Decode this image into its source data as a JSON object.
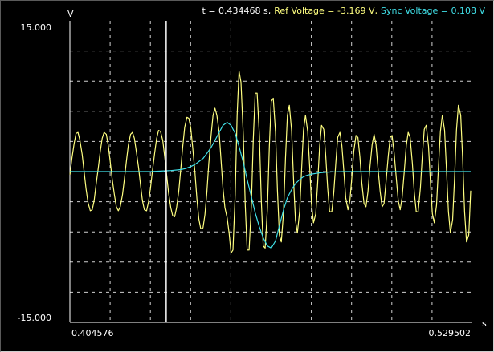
{
  "colors": {
    "background": "#000000",
    "grid": "#d0d0d0",
    "axes": "#ffffff",
    "ref": "#ffff80",
    "sync": "#40e0e8",
    "cursor": "#ffffff",
    "text": "#ffffff"
  },
  "readout": {
    "time": "t = 0.434468 s,",
    "ref": "Ref Voltage = -3.169 V,",
    "sync": "Sync Voltage =  0.108 V"
  },
  "chart_data": {
    "type": "line",
    "xlabel": "s",
    "ylabel": "V",
    "xlim": [
      0.404576,
      0.529502
    ],
    "ylim": [
      -15.0,
      15.0
    ],
    "x_tick_labels": [
      "0.404576",
      "0.529502"
    ],
    "y_tick_labels": [
      "15.000",
      "-15.000"
    ],
    "grid": true,
    "grid_divisions": {
      "x": 10,
      "y": 10
    },
    "cursor_x": 0.434468,
    "series": [
      {
        "name": "Ref Voltage",
        "color": "#ffff80",
        "x": [
          0.4046,
          0.4052,
          0.4059,
          0.4065,
          0.4071,
          0.4077,
          0.4084,
          0.409,
          0.4096,
          0.4102,
          0.4109,
          0.4115,
          0.4121,
          0.4127,
          0.4134,
          0.414,
          0.4146,
          0.4152,
          0.4159,
          0.4165,
          0.4171,
          0.4177,
          0.4184,
          0.419,
          0.4196,
          0.4202,
          0.4209,
          0.4215,
          0.4221,
          0.4227,
          0.4234,
          0.424,
          0.4246,
          0.4252,
          0.4259,
          0.4265,
          0.4271,
          0.4277,
          0.4284,
          0.429,
          0.4296,
          0.4302,
          0.4309,
          0.4315,
          0.4321,
          0.4327,
          0.4334,
          0.434,
          0.4346,
          0.4352,
          0.4359,
          0.4365,
          0.4371,
          0.4377,
          0.4384,
          0.439,
          0.4396,
          0.4402,
          0.4409,
          0.4415,
          0.4421,
          0.4427,
          0.4434,
          0.444,
          0.4446,
          0.4452,
          0.4459,
          0.4465,
          0.4471,
          0.4477,
          0.4484,
          0.449,
          0.4496,
          0.4502,
          0.4509,
          0.4515,
          0.4521,
          0.4527,
          0.4534,
          0.454,
          0.4546,
          0.4552,
          0.4559,
          0.4565,
          0.4571,
          0.4577,
          0.4584,
          0.459,
          0.4596,
          0.4602,
          0.4609,
          0.4615,
          0.4621,
          0.4627,
          0.4634,
          0.464,
          0.4646,
          0.4652,
          0.4659,
          0.4665,
          0.4671,
          0.4677,
          0.4684,
          0.469,
          0.4696,
          0.4702,
          0.4709,
          0.4715,
          0.4721,
          0.4727,
          0.4734,
          0.474,
          0.4746,
          0.4752,
          0.4759,
          0.4765,
          0.4771,
          0.4777,
          0.4784,
          0.479,
          0.4796,
          0.4802,
          0.4809,
          0.4815,
          0.4821,
          0.4827,
          0.4834,
          0.484,
          0.4846,
          0.4852,
          0.4859,
          0.4865,
          0.4871,
          0.4877,
          0.4884,
          0.489,
          0.4896,
          0.4902,
          0.4909,
          0.4915,
          0.4921,
          0.4927,
          0.4934,
          0.494,
          0.4946,
          0.4952,
          0.4959,
          0.4965,
          0.4971,
          0.4977,
          0.4984,
          0.499,
          0.4996,
          0.5002,
          0.5009,
          0.5015,
          0.5021,
          0.5027,
          0.5034,
          0.504,
          0.5046,
          0.5052,
          0.5059,
          0.5065,
          0.5071,
          0.5077,
          0.5084,
          0.509,
          0.5096,
          0.5102,
          0.5109,
          0.5115,
          0.5121,
          0.5127,
          0.5134,
          0.514,
          0.5146,
          0.5152,
          0.5159,
          0.5165,
          0.5171,
          0.5177,
          0.5184,
          0.519,
          0.5196,
          0.5202,
          0.5209,
          0.5215,
          0.5221,
          0.5227,
          0.5234,
          0.524,
          0.5246,
          0.5252,
          0.5259,
          0.5265,
          0.5271,
          0.5277,
          0.5284,
          0.529
        ],
        "y": [
          -0.3,
          1.3,
          2.8,
          3.8,
          3.9,
          3.1,
          1.7,
          0.0,
          -1.7,
          -3.1,
          -3.9,
          -3.8,
          -2.9,
          -1.3,
          0.4,
          2.0,
          3.3,
          3.9,
          3.7,
          2.6,
          1.0,
          -0.7,
          -2.3,
          -3.5,
          -3.9,
          -3.5,
          -2.3,
          -0.7,
          1.0,
          2.6,
          3.7,
          3.9,
          3.3,
          2.0,
          0.4,
          -1.3,
          -2.9,
          -3.8,
          -3.9,
          -3.0,
          -1.6,
          0.1,
          1.9,
          3.3,
          4.1,
          4.0,
          3.1,
          1.5,
          -0.3,
          -2.1,
          -3.6,
          -4.4,
          -4.5,
          -3.6,
          -1.9,
          0.3,
          2.5,
          4.4,
          5.4,
          5.3,
          4.3,
          2.4,
          -0.1,
          -2.7,
          -4.7,
          -5.7,
          -5.6,
          -4.3,
          -2.1,
          0.8,
          3.6,
          5.6,
          6.3,
          5.6,
          3.9,
          1.1,
          -1.7,
          -3.6,
          -4.6,
          -6.1,
          -8.1,
          -7.8,
          -2.3,
          5.6,
          10.0,
          8.9,
          3.6,
          -3.3,
          -7.8,
          -7.8,
          -3.4,
          3.2,
          7.8,
          7.8,
          3.6,
          -2.9,
          -7.4,
          -7.6,
          -3.7,
          2.5,
          7.0,
          7.3,
          3.9,
          -1.9,
          -6.3,
          -7.0,
          -4.0,
          1.3,
          5.6,
          6.6,
          4.1,
          -0.7,
          -4.8,
          -6.1,
          -4.0,
          0.1,
          4.1,
          5.6,
          4.0,
          0.5,
          -3.3,
          -5.1,
          -4.2,
          -1.1,
          2.5,
          4.6,
          4.2,
          1.6,
          -1.6,
          -4.0,
          -4.0,
          -2.1,
          0.8,
          3.4,
          3.9,
          2.6,
          0.1,
          -2.6,
          -3.8,
          -2.9,
          -0.6,
          2.0,
          3.6,
          3.4,
          1.5,
          -1.1,
          -3.2,
          -3.5,
          -2.0,
          0.4,
          2.7,
          3.7,
          2.7,
          0.4,
          -2.0,
          -3.5,
          -3.2,
          -1.1,
          1.5,
          3.4,
          3.6,
          2.0,
          -0.6,
          -2.9,
          -3.8,
          -2.6,
          0.1,
          2.6,
          3.9,
          3.4,
          0.8,
          -2.1,
          -4.0,
          -4.0,
          -1.6,
          1.6,
          4.2,
          4.6,
          2.5,
          -1.1,
          -4.2,
          -5.1,
          -3.3,
          0.5,
          4.0,
          5.6,
          4.1,
          0.1,
          -4.0,
          -6.1,
          -4.8,
          -0.7,
          4.1,
          6.6,
          5.6,
          1.3,
          -4.0,
          -7.0,
          -6.3,
          -1.9
        ]
      },
      {
        "name": "Sync Voltage",
        "color": "#40e0e8",
        "x": [
          0.4046,
          0.4078,
          0.4109,
          0.414,
          0.4171,
          0.4202,
          0.4234,
          0.4265,
          0.4296,
          0.4327,
          0.4359,
          0.439,
          0.4405,
          0.4421,
          0.4434,
          0.4446,
          0.4459,
          0.4471,
          0.4484,
          0.4496,
          0.4509,
          0.4521,
          0.4534,
          0.4546,
          0.4559,
          0.4571,
          0.4584,
          0.4596,
          0.4609,
          0.4621,
          0.4634,
          0.4646,
          0.4659,
          0.4671,
          0.4684,
          0.4696,
          0.4709,
          0.4721,
          0.4734,
          0.4746,
          0.4759,
          0.4771,
          0.4784,
          0.4796,
          0.4809,
          0.4821,
          0.4834,
          0.4846,
          0.4859,
          0.4871,
          0.4884,
          0.4896,
          0.4909,
          0.494,
          0.4971,
          0.5002,
          0.5034,
          0.5065,
          0.5096,
          0.5127,
          0.5159,
          0.519,
          0.5221,
          0.5252,
          0.5284,
          0.529
        ],
        "y": [
          0.0,
          0.0,
          0.0,
          0.0,
          0.0,
          0.0,
          0.0,
          0.0,
          0.0,
          0.05,
          0.1,
          0.2,
          0.3,
          0.5,
          0.7,
          1.0,
          1.3,
          1.8,
          2.4,
          3.1,
          3.9,
          4.6,
          4.9,
          4.6,
          3.8,
          2.5,
          0.9,
          -0.8,
          -2.5,
          -4.1,
          -5.5,
          -6.6,
          -7.4,
          -7.6,
          -6.9,
          -5.4,
          -3.8,
          -2.6,
          -1.8,
          -1.2,
          -0.8,
          -0.5,
          -0.35,
          -0.25,
          -0.18,
          -0.12,
          -0.08,
          -0.05,
          -0.03,
          -0.02,
          -0.01,
          0.0,
          0.0,
          0.0,
          0.0,
          0.0,
          0.0,
          0.0,
          0.0,
          0.0,
          0.0,
          0.0,
          0.0,
          0.0,
          0.0,
          0.0
        ]
      }
    ]
  }
}
